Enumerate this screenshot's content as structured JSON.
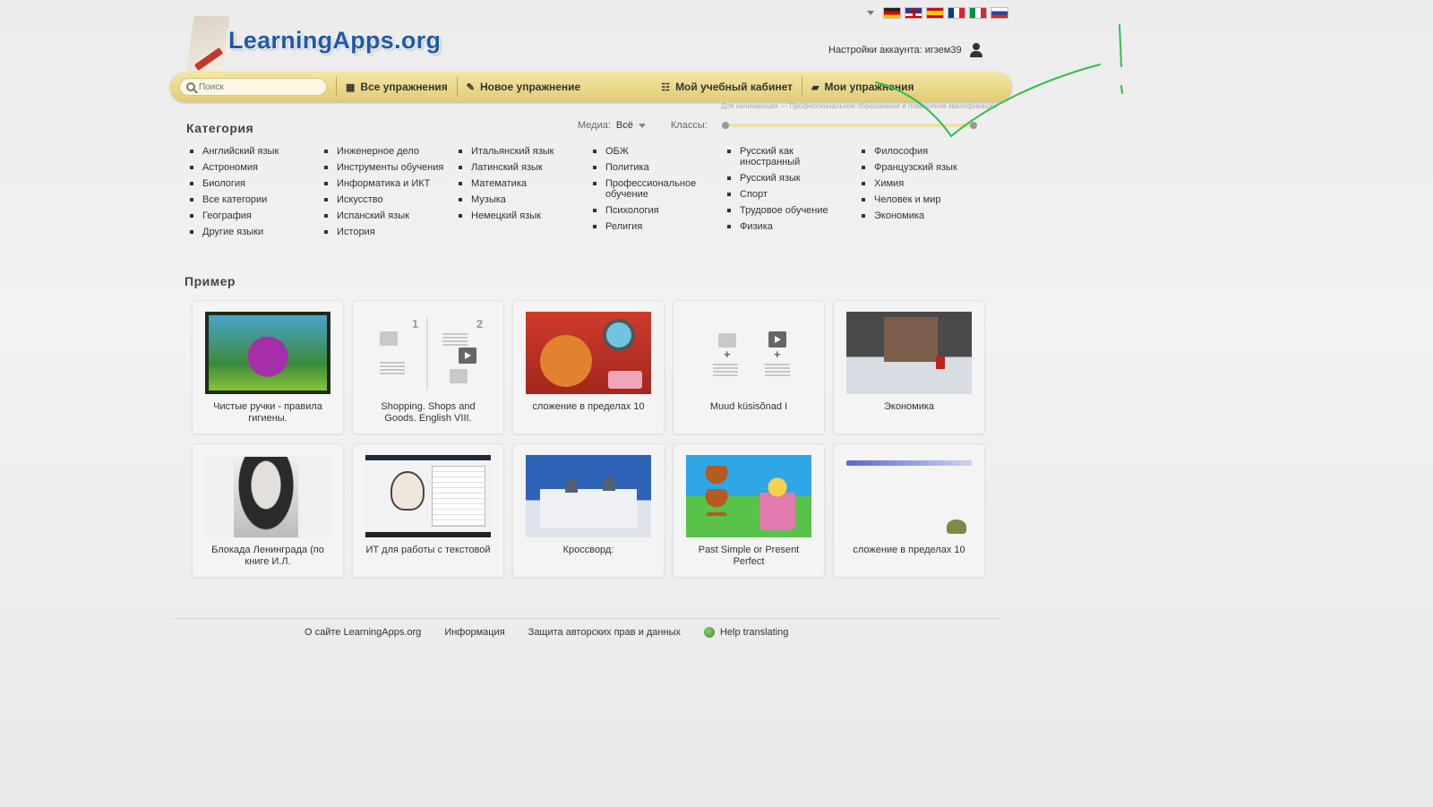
{
  "header": {
    "logo_text": "LearningApps.org",
    "languages": [
      "de",
      "en",
      "es",
      "fr",
      "it",
      "ru"
    ],
    "account_label": "Настройки аккаунта: игзем39"
  },
  "nav": {
    "search_placeholder": "Поиск",
    "all_exercises": "Все упражнения",
    "new_exercise": "Новое упражнение",
    "my_classroom": "Мой учебный кабинет",
    "my_exercises": "Мои упражнения"
  },
  "sub_line": "Для начинающих — Профессиональное образование и повышение квалификации",
  "filters": {
    "media_label": "Медиа:",
    "media_value": "Всё",
    "grades_label": "Классы:"
  },
  "categories": {
    "title": "Категория",
    "columns": [
      [
        "Английский язык",
        "Астрономия",
        "Биология",
        "Все категории",
        "География",
        "Другие языки"
      ],
      [
        "Инженерное дело",
        "Инструменты обучения",
        "Информатика и ИКТ",
        "Искусство",
        "Испанский язык",
        "История"
      ],
      [
        "Итальянский язык",
        "Латинский язык",
        "Математика",
        "Музыка",
        "Немецкий язык"
      ],
      [
        "ОБЖ",
        "Политика",
        "Профессиональное обучение",
        "Психология",
        "Религия"
      ],
      [
        "Русский как иностранный",
        "Русский язык",
        "Спорт",
        "Трудовое обучение",
        "Физика"
      ],
      [
        "Философия",
        "Французский язык",
        "Химия",
        "Человек и мир",
        "Экономика"
      ]
    ]
  },
  "examples": {
    "title": "Пример",
    "items": [
      {
        "label": "Чистые ручки - правила гигиены."
      },
      {
        "label": "Shopping. Shops and Goods. English VIII."
      },
      {
        "label": "сложение в пределах 10"
      },
      {
        "label": "Muud küsisõnad I"
      },
      {
        "label": "Экономика"
      },
      {
        "label": "Блокада Ленинграда (по книге И.Л."
      },
      {
        "label": "ИТ для работы с текстовой"
      },
      {
        "label": "Кроссворд:"
      },
      {
        "label": "Past Simple or Present Perfect"
      },
      {
        "label": "сложение в пределах 10"
      }
    ]
  },
  "footer": {
    "about": "О сайте LearningApps.org",
    "info": "Информация",
    "privacy": "Защита авторских прав и данных",
    "help_translating": "Help translating"
  },
  "colors": {
    "navbar": "#e8d583",
    "logo": "#1f5aa6",
    "annotation": "#2fbf4a"
  }
}
